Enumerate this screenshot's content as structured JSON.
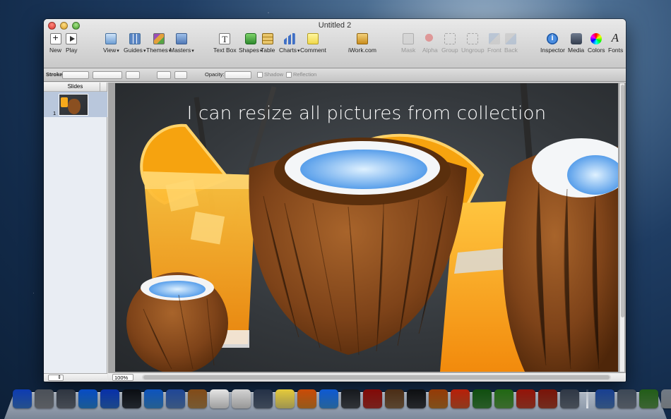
{
  "window": {
    "title": "Untitled 2"
  },
  "toolbar": {
    "new": "New",
    "play": "Play",
    "view": "View",
    "guides": "Guides",
    "themes": "Themes",
    "masters": "Masters",
    "textbox": "Text Box",
    "shapes": "Shapes",
    "table": "Table",
    "charts": "Charts",
    "comment": "Comment",
    "iwork": "iWork.com",
    "mask": "Mask",
    "alpha": "Alpha",
    "group": "Group",
    "ungroup": "Ungroup",
    "front": "Front",
    "back": "Back",
    "inspector": "Inspector",
    "media": "Media",
    "colors": "Colors",
    "fonts": "Fonts"
  },
  "format_bar": {
    "stroke_label": "Stroke",
    "opacity_label": "Opacity:",
    "shadow_label": "Shadow",
    "reflection_label": "Reflection"
  },
  "sidebar": {
    "header": "Slides",
    "slides": [
      {
        "number": "1"
      }
    ]
  },
  "slide": {
    "title": "I can resize all pictures from collection"
  },
  "status": {
    "zoom": "100%"
  },
  "dock": {
    "icons": [
      {
        "name": "finder-icon",
        "color": "#3a7bd5"
      },
      {
        "name": "system-preferences-icon",
        "color": "#8a8f96"
      },
      {
        "name": "launchpad-icon",
        "color": "#6c7480"
      },
      {
        "name": "app-store-icon",
        "color": "#2a8be0"
      },
      {
        "name": "itunes-icon",
        "color": "#2c6fd0"
      },
      {
        "name": "dashboard-icon",
        "color": "#333a44"
      },
      {
        "name": "safari-icon",
        "color": "#3a92dc"
      },
      {
        "name": "mail-icon",
        "color": "#5a86c4"
      },
      {
        "name": "contacts-icon",
        "color": "#b68a4e"
      },
      {
        "name": "calendar-icon",
        "color": "#f2f2f2"
      },
      {
        "name": "reminders-icon",
        "color": "#e8e8e8"
      },
      {
        "name": "iphoto-icon",
        "color": "#5f6f86"
      },
      {
        "name": "notes-icon",
        "color": "#f2e37a"
      },
      {
        "name": "pages-icon",
        "color": "#e38a2a"
      },
      {
        "name": "messages-icon",
        "color": "#3b97e8"
      },
      {
        "name": "facetime-icon",
        "color": "#4a4f56"
      },
      {
        "name": "photo-booth-icon",
        "color": "#b6332c"
      },
      {
        "name": "image-capture-icon",
        "color": "#8a6b4a"
      },
      {
        "name": "imovie-icon",
        "color": "#3a3d42"
      },
      {
        "name": "garageband-icon",
        "color": "#c37a2a"
      },
      {
        "name": "game-icon",
        "color": "#d85a2f"
      },
      {
        "name": "books-icon",
        "color": "#3f8d3e"
      },
      {
        "name": "folder-stack-icon",
        "color": "#5ba347"
      },
      {
        "name": "photo-stack-icon",
        "color": "#c2462f"
      },
      {
        "name": "presentation-icon",
        "color": "#b0462f"
      },
      {
        "name": "preview-icon",
        "color": "#6d7785"
      },
      {
        "name": "downloads-stack-icon",
        "color": "#4e7fc1"
      },
      {
        "name": "screenshot-stack-icon",
        "color": "#7c8794"
      },
      {
        "name": "documents-stack-icon",
        "color": "#5d9a4f"
      },
      {
        "name": "trash-icon",
        "color": "#a9b0b8"
      }
    ]
  }
}
